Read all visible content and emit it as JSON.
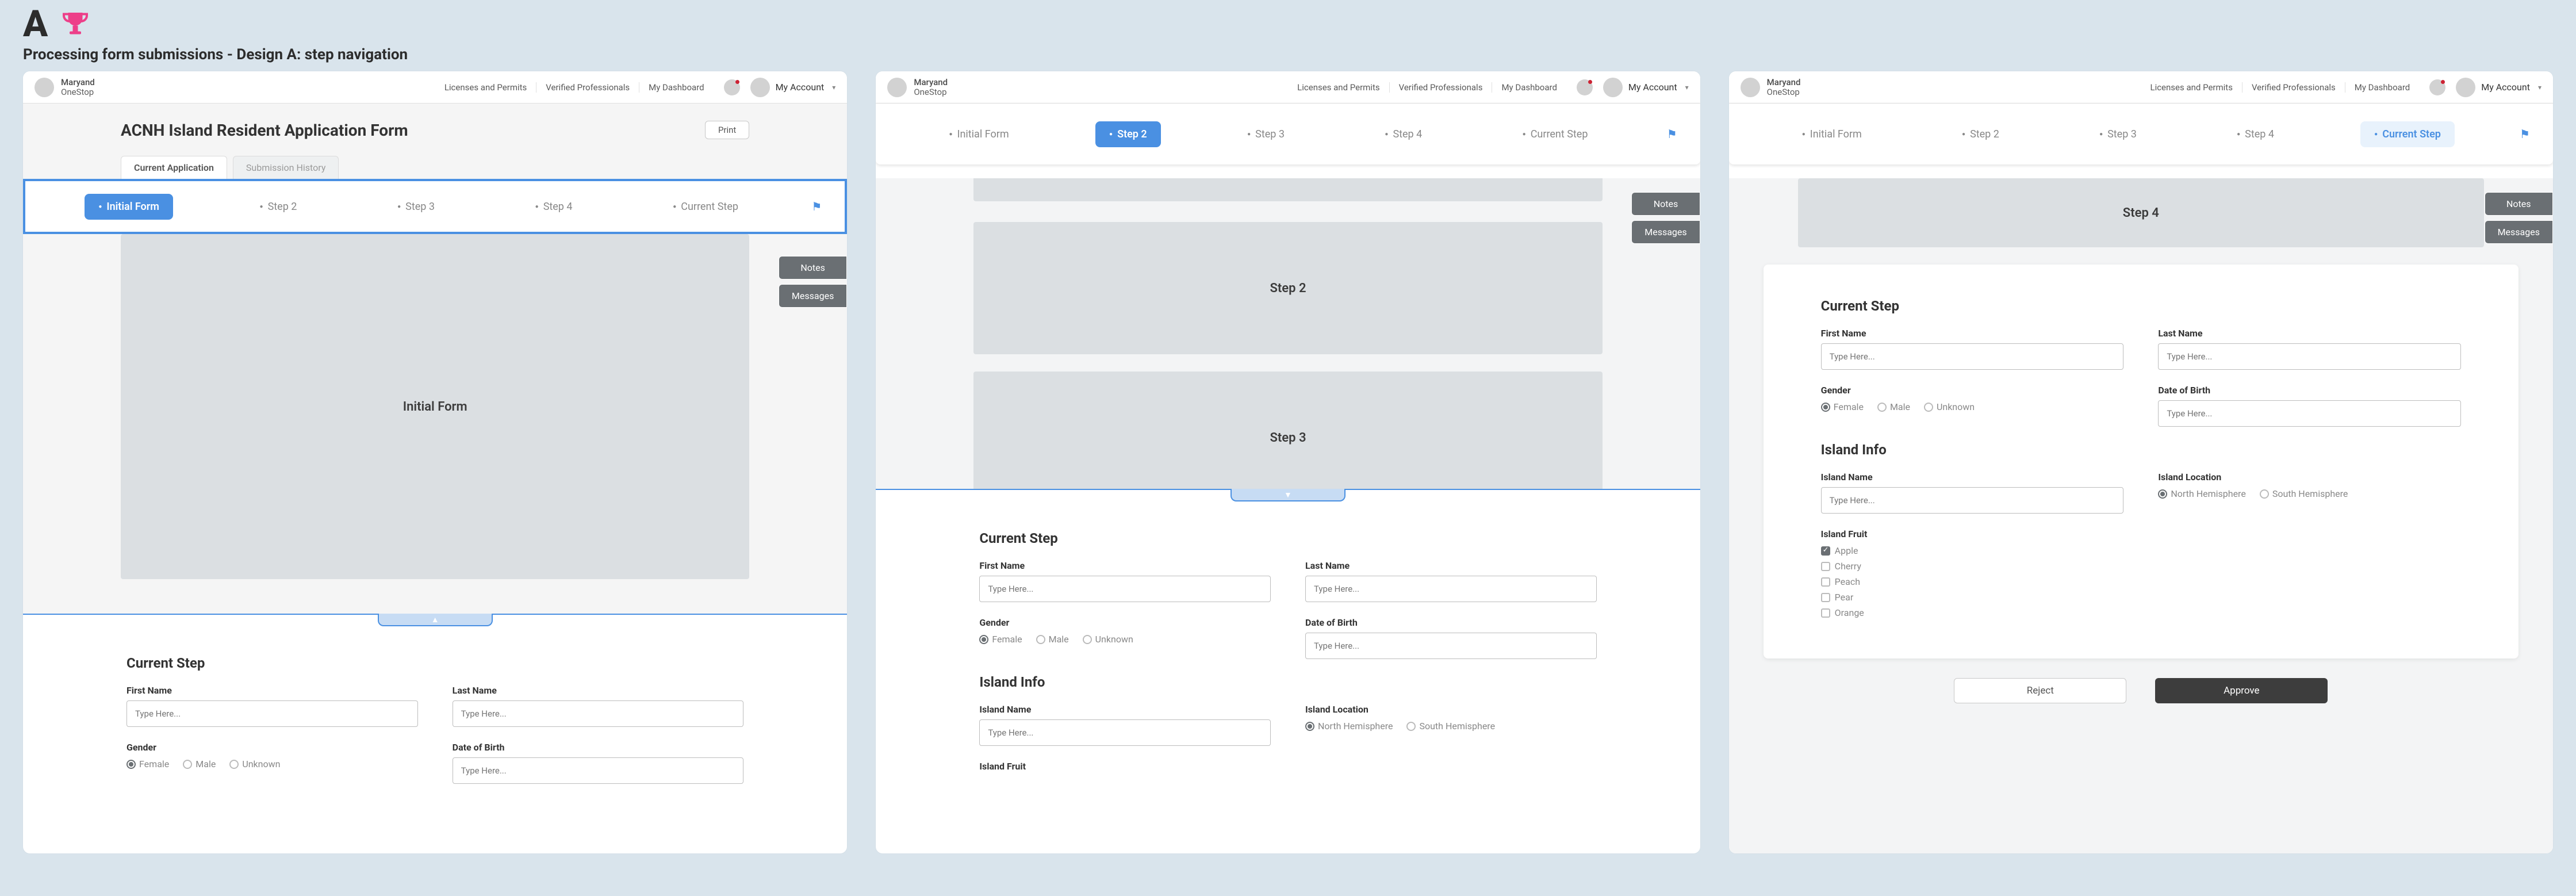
{
  "title_letter": "A",
  "subtitle": "Processing form submissions - Design A: step navigation",
  "brand": {
    "line1": "Maryand",
    "line2": "OneStop"
  },
  "nav": {
    "links": [
      "Licenses and Permits",
      "Verified Professionals",
      "My Dashboard"
    ],
    "account": "My Account"
  },
  "header": {
    "form_title": "ACNH Island Resident Application Form",
    "print": "Print",
    "tabs": [
      "Current Application",
      "Submission History"
    ]
  },
  "steps": [
    "Initial Form",
    "Step 2",
    "Step 3",
    "Step 4",
    "Current Step"
  ],
  "side": {
    "notes": "Notes",
    "messages": "Messages"
  },
  "slabs": {
    "initial": "Initial Form",
    "step2": "Step 2",
    "step3": "Step 3",
    "step4": "Step 4"
  },
  "form": {
    "section_current": "Current Step",
    "first_name": "First Name",
    "last_name": "Last Name",
    "gender": "Gender",
    "gender_opts": [
      "Female",
      "Male",
      "Unknown"
    ],
    "dob": "Date of Birth",
    "placeholder": "Type Here...",
    "island_section": "Island Info",
    "island_name": "Island Name",
    "island_location": "Island Location",
    "loc_opts": [
      "North Hemisphere",
      "South Hemisphere"
    ],
    "island_fruit": "Island Fruit",
    "fruits": [
      "Apple",
      "Cherry",
      "Peach",
      "Pear",
      "Orange"
    ]
  },
  "actions": {
    "reject": "Reject",
    "approve": "Approve"
  }
}
